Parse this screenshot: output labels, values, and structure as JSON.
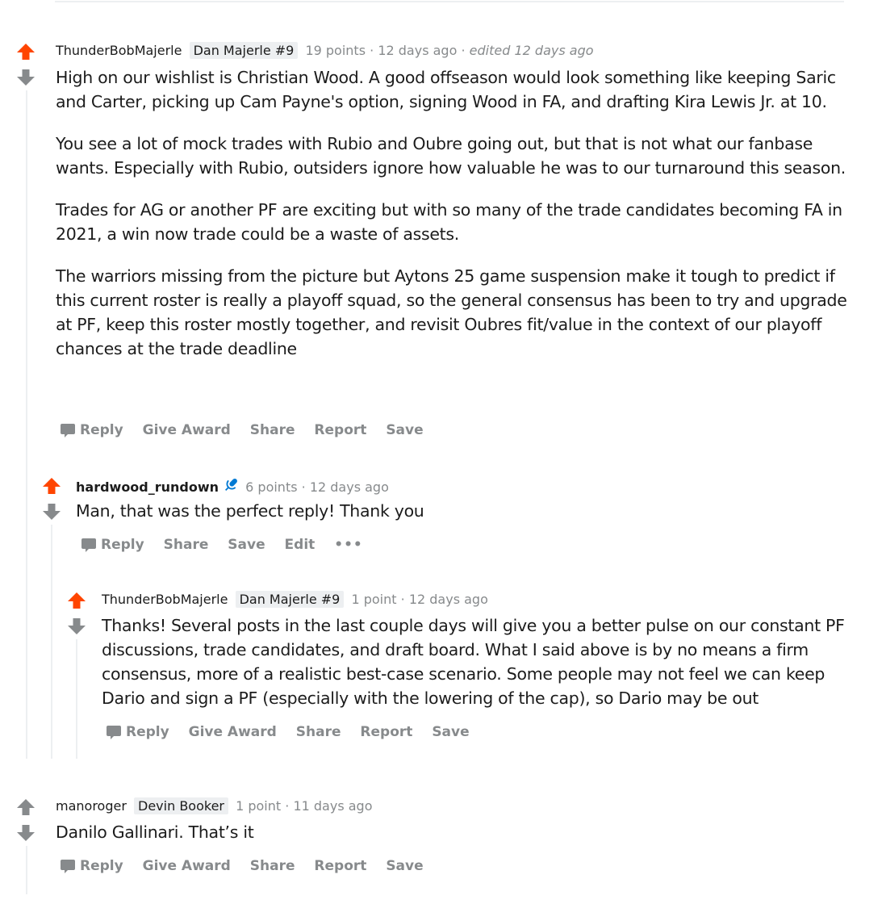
{
  "comments": [
    {
      "username": "ThunderBobMajerle",
      "flair": "Dan Majerle #9",
      "points": "19 points",
      "time": "12 days ago",
      "edited": "edited 12 days ago",
      "paragraphs": [
        "High on our wishlist is Christian Wood. A good offseason would look something like keeping Saric and Carter, picking up Cam Payne's option, signing Wood in FA, and drafting Kira Lewis Jr. at 10.",
        "You see a lot of mock trades with Rubio and Oubre going out, but that is not what our fanbase wants. Especially with Rubio, outsiders ignore how valuable he was to our turnaround this season.",
        "Trades for AG or another PF are exciting but with so many of the trade candidates becoming FA in 2021, a win now trade could be a waste of assets.",
        "The warriors missing from the picture but Aytons 25 game suspension make it tough to predict if this current roster is really a playoff squad, so the general consensus has been to try and upgrade at PF, keep this roster mostly together, and revisit Oubres fit/value in the context of our playoff chances at the trade deadline"
      ],
      "actions": [
        "Reply",
        "Give Award",
        "Share",
        "Report",
        "Save"
      ]
    },
    {
      "username": "hardwood_rundown",
      "points": "6 points",
      "time": "12 days ago",
      "paragraphs": [
        "Man, that was the perfect reply! Thank you"
      ],
      "actions": [
        "Reply",
        "Share",
        "Save",
        "Edit",
        "•••"
      ]
    },
    {
      "username": "ThunderBobMajerle",
      "flair": "Dan Majerle #9",
      "points": "1 point",
      "time": "12 days ago",
      "paragraphs": [
        "Thanks! Several posts in the last couple days will give you a better pulse on our constant PF discussions, trade candidates, and draft board. What I said above is by no means a firm consensus, more of a realistic best-case scenario. Some people may not feel we can keep Dario and sign a PF (especially with the lowering of the cap), so Dario may be out"
      ],
      "actions": [
        "Reply",
        "Give Award",
        "Share",
        "Report",
        "Save"
      ]
    },
    {
      "username": "manoroger",
      "flair": "Devin Booker",
      "points": "1 point",
      "time": "11 days ago",
      "paragraphs": [
        "Danilo Gallinari. That’s it"
      ],
      "actions": [
        "Reply",
        "Give Award",
        "Share",
        "Report",
        "Save"
      ]
    }
  ],
  "separator": "·",
  "colors": {
    "upvoted": "#ff4500",
    "neutral": "#878a8c",
    "mic": "#0079d3"
  },
  "icons": {
    "upvote": "arrow-up-icon",
    "downvote": "arrow-down-icon",
    "reply": "comment-bubble-icon",
    "op": "microphone-icon"
  }
}
